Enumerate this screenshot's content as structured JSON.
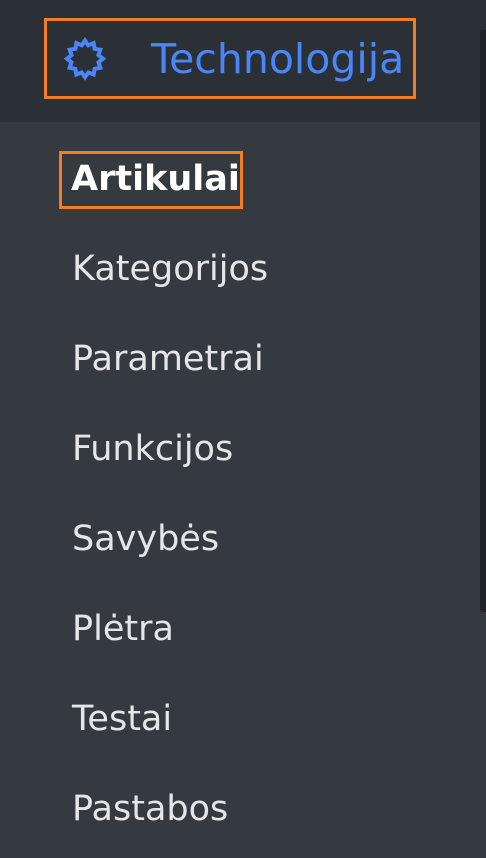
{
  "brand": {
    "title": "Technologija",
    "icon": "gear-icon",
    "accent_color": "#4a86f5",
    "highlight_color": "#f47d20"
  },
  "menu": {
    "items": [
      {
        "label": "Artikulai",
        "active": true
      },
      {
        "label": "Kategorijos",
        "active": false
      },
      {
        "label": "Parametrai",
        "active": false
      },
      {
        "label": "Funkcijos",
        "active": false
      },
      {
        "label": "Savybės",
        "active": false
      },
      {
        "label": "Plėtra",
        "active": false
      },
      {
        "label": "Testai",
        "active": false
      },
      {
        "label": "Pastabos",
        "active": false
      }
    ]
  }
}
